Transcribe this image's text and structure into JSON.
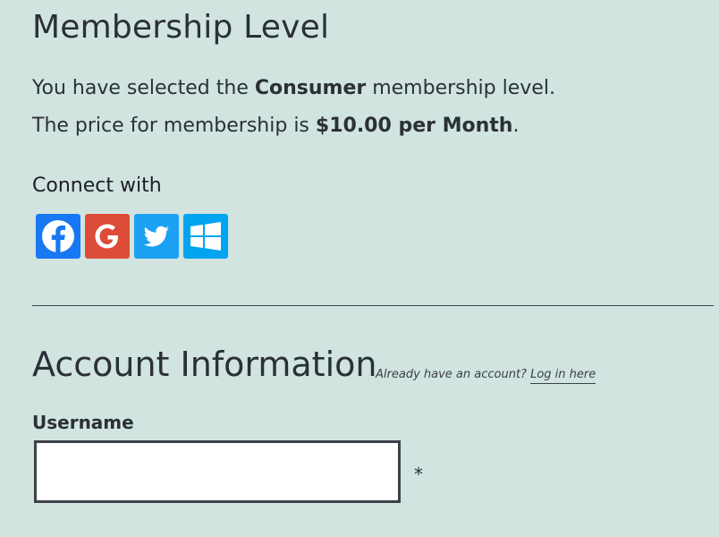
{
  "membership": {
    "title": "Membership Level",
    "selected_prefix": "You have selected the ",
    "level_name": "Consumer",
    "selected_suffix": " membership level.",
    "price_prefix": "The price for membership is ",
    "price": "$10.00 per Month",
    "price_suffix": "."
  },
  "connect": {
    "label": "Connect with",
    "providers": [
      {
        "name": "Facebook",
        "icon": "facebook-icon",
        "color": "#1877f2"
      },
      {
        "name": "Google",
        "icon": "google-icon",
        "color": "#dd4b39"
      },
      {
        "name": "Twitter",
        "icon": "twitter-icon",
        "color": "#1da1f2"
      },
      {
        "name": "Windows",
        "icon": "windows-icon",
        "color": "#00a4ef"
      }
    ]
  },
  "account": {
    "title": "Account Information",
    "login_prompt": "Already have an account? ",
    "login_link": "Log in here",
    "username_label": "Username",
    "username_value": "",
    "required_marker": "*"
  }
}
